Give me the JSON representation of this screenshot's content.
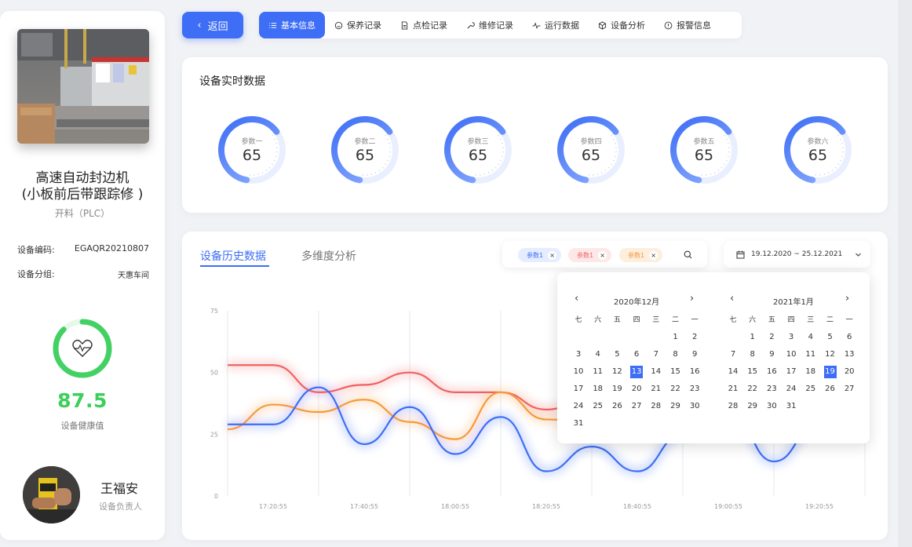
{
  "machine": {
    "name_line1": "高速自动封边机",
    "name_line2": "(小板前后带跟踪修 )",
    "subtitle": "开料（PLC）",
    "code_label": "设备编码:",
    "code_value": "EGAQR20210807",
    "group_label": "设备分组:",
    "group_value": "天惠车间",
    "health_value": "87.5",
    "health_percent": 87.5,
    "health_label": "设备健康值",
    "owner_name": "王福安",
    "owner_role": "设备负责人"
  },
  "nav": {
    "back_label": "返回",
    "tabs": [
      {
        "label": "基本信息",
        "icon": "list-icon",
        "active": true
      },
      {
        "label": "保养记录",
        "icon": "smile-icon",
        "active": false
      },
      {
        "label": "点检记录",
        "icon": "document-icon",
        "active": false
      },
      {
        "label": "维修记录",
        "icon": "wrench-icon",
        "active": false
      },
      {
        "label": "运行数据",
        "icon": "pulse-icon",
        "active": false
      },
      {
        "label": "设备分析",
        "icon": "cube-icon",
        "active": false
      },
      {
        "label": "报警信息",
        "icon": "alert-icon",
        "active": false
      }
    ]
  },
  "realtime": {
    "title": "设备实时数据",
    "gauges": [
      {
        "label": "参数一",
        "value": "65"
      },
      {
        "label": "参数二",
        "value": "65"
      },
      {
        "label": "参数三",
        "value": "65"
      },
      {
        "label": "参数四",
        "value": "65"
      },
      {
        "label": "参数五",
        "value": "65"
      },
      {
        "label": "参数六",
        "value": "65"
      }
    ]
  },
  "history": {
    "tab_active": "设备历史数据",
    "tab_inactive": "多维度分析",
    "chips": [
      {
        "label": "参数1",
        "color": "#3d6ef5",
        "bg": "#e6edff"
      },
      {
        "label": "参数1",
        "color": "#f06262",
        "bg": "#fde8e8"
      },
      {
        "label": "参数1",
        "color": "#f59a3a",
        "bg": "#fdeedd"
      }
    ],
    "date_range": "19.12.2020 ~ 25.12.2021",
    "chip_close": "×"
  },
  "chart_data": {
    "type": "line",
    "x": [
      "17:20:55",
      "17:40:55",
      "18:00:55",
      "18:20:55",
      "18:40:55",
      "19:00:55",
      "19:20:55"
    ],
    "yticks": [
      "0",
      "25",
      "50",
      "75"
    ],
    "ylim": [
      0,
      75
    ],
    "series": [
      {
        "color": "#f06262",
        "points": [
          [
            0,
            53
          ],
          [
            0.5,
            53
          ],
          [
            1,
            42
          ],
          [
            1.5,
            45
          ],
          [
            2,
            50
          ],
          [
            2.5,
            42
          ],
          [
            3,
            42
          ],
          [
            3.5,
            35
          ],
          [
            4,
            40
          ],
          [
            6.5,
            55
          ]
        ]
      },
      {
        "color": "#f59a3a",
        "points": [
          [
            0,
            27
          ],
          [
            0.5,
            37
          ],
          [
            1,
            34
          ],
          [
            1.5,
            39
          ],
          [
            2,
            30
          ],
          [
            2.5,
            23
          ],
          [
            3,
            42
          ],
          [
            3.5,
            31
          ],
          [
            4,
            30
          ],
          [
            6.5,
            40
          ]
        ]
      },
      {
        "color": "#3d6ef5",
        "points": [
          [
            0,
            29
          ],
          [
            0.5,
            29
          ],
          [
            1,
            44
          ],
          [
            1.5,
            21
          ],
          [
            2,
            36
          ],
          [
            2.5,
            17
          ],
          [
            3,
            32
          ],
          [
            3.5,
            10
          ],
          [
            4,
            20
          ],
          [
            4.5,
            10
          ],
          [
            5,
            25
          ],
          [
            5.5,
            35
          ],
          [
            6,
            14
          ],
          [
            6.5,
            30
          ]
        ]
      }
    ]
  },
  "calendar": {
    "left": {
      "title": "2020年12月",
      "weekdays": [
        "七",
        "六",
        "五",
        "四",
        "三",
        "二",
        "一"
      ],
      "rows": [
        [
          "",
          "",
          "",
          "",
          "",
          "1",
          "2"
        ],
        [
          "3",
          "4",
          "5",
          "6",
          "7",
          "8",
          "9"
        ],
        [
          "10",
          "11",
          "12",
          "13",
          "14",
          "15",
          "16"
        ],
        [
          "17",
          "18",
          "19",
          "20",
          "21",
          "22",
          "23"
        ],
        [
          "24",
          "25",
          "26",
          "27",
          "28",
          "29",
          "30"
        ],
        [
          "31",
          "",
          "",
          "",
          "",
          "",
          ""
        ]
      ],
      "selected": "13"
    },
    "right": {
      "title": "2021年1月",
      "weekdays": [
        "七",
        "六",
        "五",
        "四",
        "三",
        "二",
        "一"
      ],
      "rows": [
        [
          "",
          "1",
          "2",
          "3",
          "4",
          "5",
          "6"
        ],
        [
          "7",
          "8",
          "9",
          "10",
          "11",
          "12",
          "13"
        ],
        [
          "14",
          "15",
          "16",
          "17",
          "18",
          "19",
          "20"
        ],
        [
          "21",
          "22",
          "23",
          "24",
          "25",
          "26",
          "27"
        ],
        [
          "28",
          "29",
          "30",
          "31",
          "",
          "",
          ""
        ]
      ],
      "selected": "19"
    },
    "prev": "‹",
    "next": "›"
  }
}
